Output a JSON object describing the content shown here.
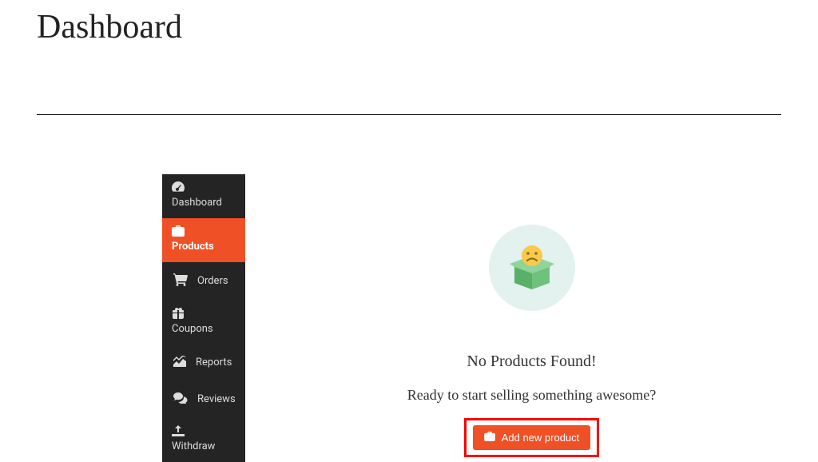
{
  "header": {
    "title": "Dashboard"
  },
  "sidebar": {
    "items": [
      {
        "label": "Dashboard"
      },
      {
        "label": "Products"
      },
      {
        "label": "Orders"
      },
      {
        "label": "Coupons"
      },
      {
        "label": "Reports"
      },
      {
        "label": "Reviews"
      },
      {
        "label": "Withdraw"
      }
    ]
  },
  "main": {
    "empty_title": "No Products Found!",
    "empty_subtitle": "Ready to start selling something awesome?",
    "add_button_label": "Add new product"
  },
  "colors": {
    "accent": "#f05025",
    "sidebar_bg": "#242424",
    "highlight": "#f00"
  }
}
